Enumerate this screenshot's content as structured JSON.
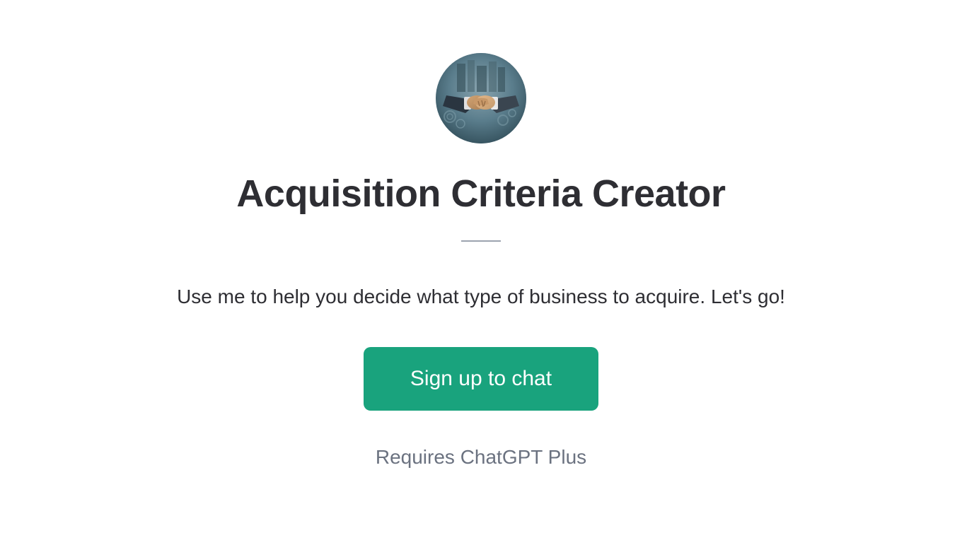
{
  "avatar": {
    "alt": "handshake-business-icon"
  },
  "title": "Acquisition Criteria Creator",
  "description": "Use me to help you decide what type of business to acquire. Let's go!",
  "cta": {
    "label": "Sign up to chat"
  },
  "footer": {
    "requirement": "Requires ChatGPT Plus"
  }
}
